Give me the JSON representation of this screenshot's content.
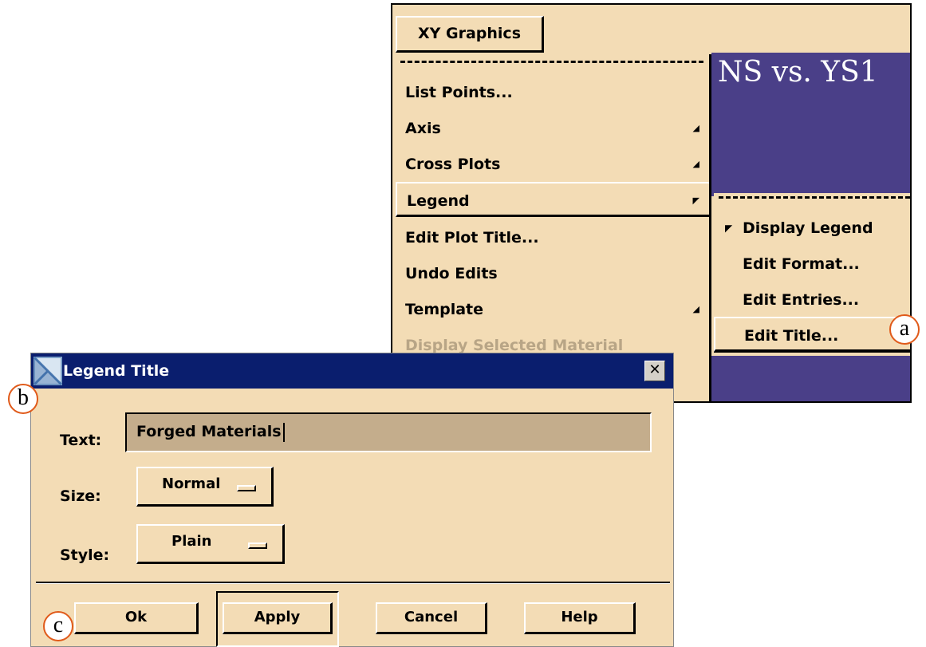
{
  "menubar": {
    "label": "XY Graphics"
  },
  "plot": {
    "title": "NS vs. YS1"
  },
  "main_menu": {
    "items": [
      {
        "label": "List Points..."
      },
      {
        "label": "Axis"
      },
      {
        "label": "Cross Plots"
      },
      {
        "label": "Legend"
      },
      {
        "label": "Edit Plot Title..."
      },
      {
        "label": "Undo Edits"
      },
      {
        "label": "Template"
      },
      {
        "label": "Display Selected Material"
      }
    ]
  },
  "sub_menu": {
    "items": [
      {
        "label": "Display Legend",
        "checked": true
      },
      {
        "label": "Edit Format..."
      },
      {
        "label": "Edit Entries..."
      },
      {
        "label": "Edit Title..."
      }
    ]
  },
  "callouts": {
    "a": "a",
    "b": "b",
    "c": "c"
  },
  "dialog": {
    "title": "Legend Title",
    "close": "✕",
    "text_label": "Text:",
    "text_value": "Forged Materials",
    "size_label": "Size:",
    "size_value": "Normal",
    "style_label": "Style:",
    "style_value": "Plain",
    "buttons": {
      "ok": "Ok",
      "apply": "Apply",
      "cancel": "Cancel",
      "help": "Help"
    }
  },
  "colors": {
    "panel": "#f3dcb5",
    "plot_background": "#4a3f88",
    "titlebar": "#0a1e6e",
    "callout_ring": "#e05a1a",
    "input_background": "#c4ad8c"
  }
}
